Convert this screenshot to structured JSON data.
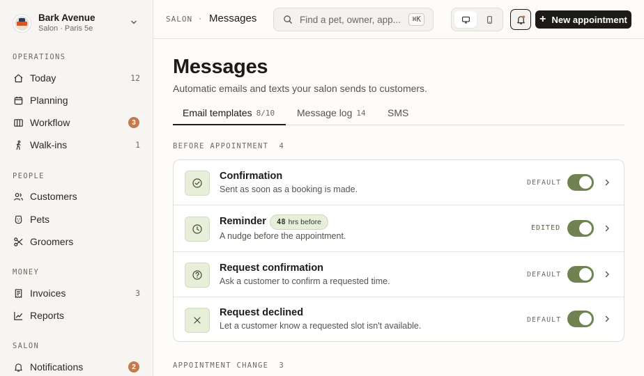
{
  "brand": {
    "name": "Bark Avenue",
    "subtitle": "Salon · Paris 5e"
  },
  "sidebar": {
    "sections": [
      {
        "title": "OPERATIONS"
      },
      {
        "title": "PEOPLE"
      },
      {
        "title": "MONEY"
      },
      {
        "title": "SALON"
      }
    ],
    "items": [
      {
        "label": "Today",
        "count": "12",
        "icon": "home-icon"
      },
      {
        "label": "Planning",
        "icon": "calendar-icon"
      },
      {
        "label": "Workflow",
        "badge": "3",
        "icon": "columns-icon"
      },
      {
        "label": "Walk-ins",
        "count": "1",
        "icon": "walking-icon"
      },
      {
        "label": "Customers",
        "icon": "users-icon"
      },
      {
        "label": "Pets",
        "icon": "pet-icon"
      },
      {
        "label": "Groomers",
        "icon": "scissors-icon"
      },
      {
        "label": "Invoices",
        "count": "3",
        "icon": "receipt-icon"
      },
      {
        "label": "Reports",
        "icon": "chart-line-icon"
      },
      {
        "label": "Notifications",
        "badge": "2",
        "icon": "bell-icon"
      }
    ]
  },
  "topbar": {
    "crumb_section": "SALON",
    "crumb_sep": "·",
    "crumb_page": "Messages",
    "search_placeholder": "Find a pet, owner, app...",
    "search_shortcut": "⌘K",
    "new_button": "New appointment"
  },
  "page": {
    "title": "Messages",
    "subtitle": "Automatic emails and texts your salon sends to customers."
  },
  "tabs": [
    {
      "label": "Email templates",
      "count": "8/10",
      "active": true
    },
    {
      "label": "Message log",
      "count": "14"
    },
    {
      "label": "SMS"
    }
  ],
  "groups": [
    {
      "title": "BEFORE APPOINTMENT",
      "count": "4",
      "rows": [
        {
          "title": "Confirmation",
          "desc": "Sent as soon as a booking is made.",
          "status": "DEFAULT",
          "enabled": true,
          "icon": "check-circle-icon"
        },
        {
          "title": "Reminder",
          "pill_value": "48",
          "pill_text": "hrs before",
          "desc": "A nudge before the appointment.",
          "status": "EDITED",
          "enabled": true,
          "icon": "clock-icon"
        },
        {
          "title": "Request confirmation",
          "desc": "Ask a customer to confirm a requested time.",
          "status": "DEFAULT",
          "enabled": true,
          "icon": "question-circle-icon"
        },
        {
          "title": "Request declined",
          "desc": "Let a customer know a requested slot isn't available.",
          "status": "DEFAULT",
          "enabled": true,
          "icon": "x-icon"
        }
      ]
    },
    {
      "title": "APPOINTMENT CHANGE",
      "count": "3"
    }
  ],
  "colors": {
    "accent_green": "#6e8350",
    "badge_orange": "#c47a4a",
    "icon_bg": "#e7efdb"
  }
}
